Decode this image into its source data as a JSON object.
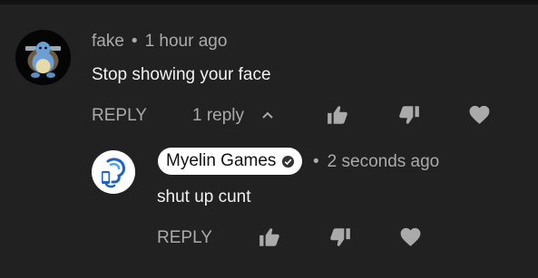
{
  "top_comment": {
    "author": "fake",
    "separator": "•",
    "timestamp": "1 hour ago",
    "text": "Stop showing your face",
    "reply_label": "REPLY",
    "replies_toggle": "1 reply",
    "icons": {
      "expand": "chevron-up-icon",
      "like": "thumbs-up-icon",
      "dislike": "thumbs-down-icon",
      "heart": "heart-icon"
    }
  },
  "reply_comment": {
    "author": "Myelin Games",
    "verified_icon": "verified-check-icon",
    "separator": "•",
    "timestamp": "2 seconds ago",
    "text": "shut up cunt",
    "reply_label": "REPLY",
    "icons": {
      "like": "thumbs-up-icon",
      "dislike": "thumbs-down-icon",
      "heart": "heart-icon"
    }
  },
  "colors": {
    "background": "#212121",
    "secondary_text": "#aaaaaa",
    "primary_text": "#f1f1f1",
    "author_chip": "#ffffff"
  }
}
